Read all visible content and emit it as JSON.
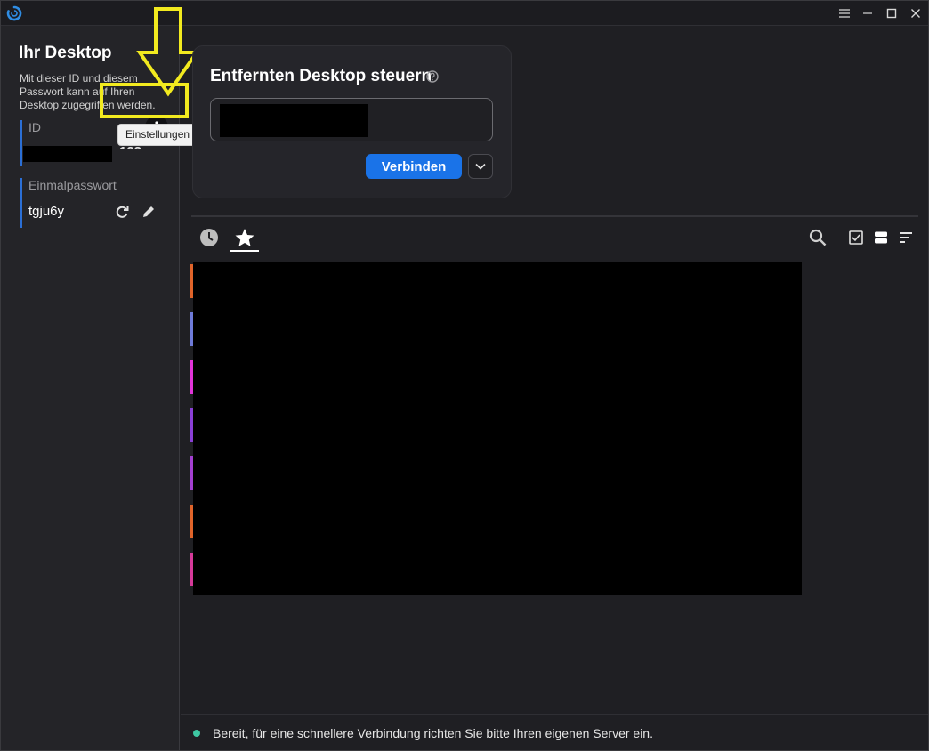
{
  "titlebar": {
    "logo_icon": "rustdesk-logo-icon",
    "buttons": [
      "menu-icon",
      "maximize-icon",
      "restore-icon",
      "close-icon"
    ]
  },
  "sidebar": {
    "title": "Ihr Desktop",
    "description": "Mit dieser ID und diesem Passwort kann auf Ihren Desktop zugegriffen werden.",
    "id_label": "ID",
    "id_value_partial": "123",
    "settings_tooltip": "Einstellungen",
    "password_label": "Einmalpasswort",
    "password_value": "tgju6y"
  },
  "connect": {
    "title": "Entfernten Desktop steuern",
    "connect_label": "Verbinden"
  },
  "toolbar": {
    "tabs": [
      "recent-sessions",
      "favorites"
    ],
    "active_tab": "favorites"
  },
  "status": {
    "prefix": "Bereit, ",
    "link": "für eine schnellere Verbindung richten Sie bitte Ihren eigenen Server ein."
  },
  "colors": {
    "accent": "#1a73e8",
    "highlight": "#f2ea1f",
    "status_ok": "#3ec7a2",
    "peer_edges": [
      "#e0642a",
      "#6f7bd9",
      "#e234d9",
      "#8a3fd6",
      "#a33fd0",
      "#e0642a",
      "#d63a9a"
    ]
  }
}
